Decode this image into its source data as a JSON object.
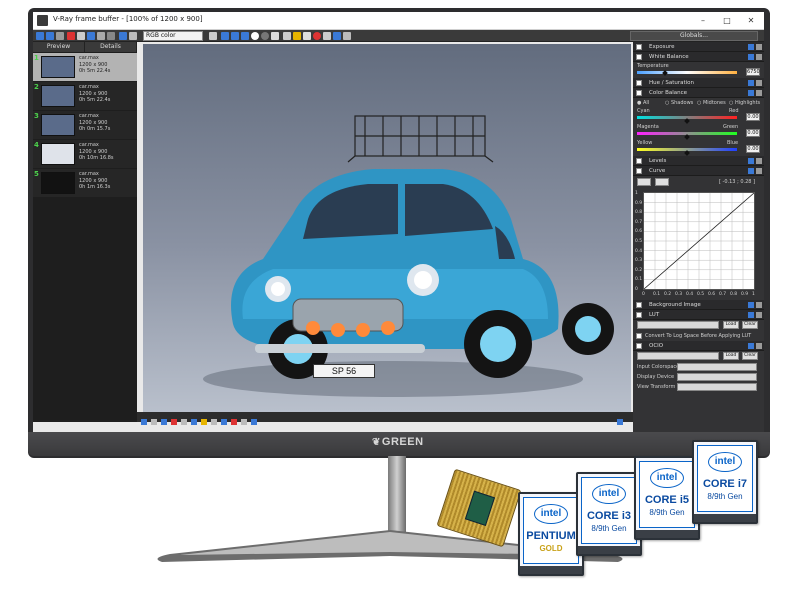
{
  "window": {
    "title": "V-Ray frame buffer - [100% of 1200 x 900]",
    "min": "–",
    "max": "□",
    "close": "✕"
  },
  "toolbar": {
    "channel": "RGB color",
    "globals": "Globals..."
  },
  "history": {
    "tabs": [
      "Preview",
      "Details"
    ],
    "items": [
      {
        "num": "1",
        "name": "car.max",
        "res": "1200 x 900",
        "time": "0h 5m 22.4s"
      },
      {
        "num": "2",
        "name": "car.max",
        "res": "1200 x 900",
        "time": "0h 5m 22.4s"
      },
      {
        "num": "3",
        "name": "car.max",
        "res": "1200 x 900",
        "time": "0h 0m 15.7s"
      },
      {
        "num": "4",
        "name": "car.max",
        "res": "1200 x 900",
        "time": "0h 10m 16.8s"
      },
      {
        "num": "5",
        "name": "car.max",
        "res": "1200 x 900",
        "time": "0h 1m 16.3s"
      }
    ]
  },
  "render": {
    "plate": "SP 56"
  },
  "panel": {
    "exposure": "Exposure",
    "white_balance": "White Balance",
    "temperature": "Temperature",
    "temperature_value": "6750",
    "hue_saturation": "Hue / Saturation",
    "color_balance": "Color Balance",
    "cb_all": "All",
    "cb_shadows": "Shadows",
    "cb_midtones": "Midtones",
    "cb_highlights": "Highlights",
    "cyan": "Cyan",
    "red": "Red",
    "magenta": "Magenta",
    "green": "Green",
    "yellow": "Yellow",
    "blue": "Blue",
    "zero": "0.00",
    "levels": "Levels",
    "curve": "Curve",
    "curve_coords": "[ -0.13 ; 0.28 ]",
    "curve_y": [
      "1",
      "0.9",
      "0.8",
      "0.7",
      "0.6",
      "0.5",
      "0.4",
      "0.3",
      "0.2",
      "0.1",
      "0"
    ],
    "curve_x": [
      "0",
      "0.1",
      "0.2",
      "0.3",
      "0.4",
      "0.5",
      "0.6",
      "0.7",
      "0.8",
      "0.9",
      "1"
    ],
    "background_image": "Background Image",
    "lut": "LUT",
    "load": "Load",
    "clear": "Clear",
    "convert_log": "Convert To Log Space Before Applying LUT",
    "ocio": "OCIO",
    "input_colorspace": "Input Colorspace",
    "display_device": "Display Device",
    "view_transform": "View Transform"
  },
  "monitor": {
    "brand": "GREEN"
  },
  "cpus": [
    {
      "brand": "intel",
      "name": "PENTIUM",
      "sub": "GOLD"
    },
    {
      "brand": "intel",
      "name": "CORE i3",
      "sub": "8/9th Gen"
    },
    {
      "brand": "intel",
      "name": "CORE i5",
      "sub": "8/9th Gen"
    },
    {
      "brand": "intel",
      "name": "CORE i7",
      "sub": "8/9th Gen"
    }
  ],
  "colors": {
    "bezel": "#2d2d2f",
    "car_body": "#2f95c4",
    "intel_blue": "#0a64c8",
    "history_green": "#4cd14c"
  }
}
